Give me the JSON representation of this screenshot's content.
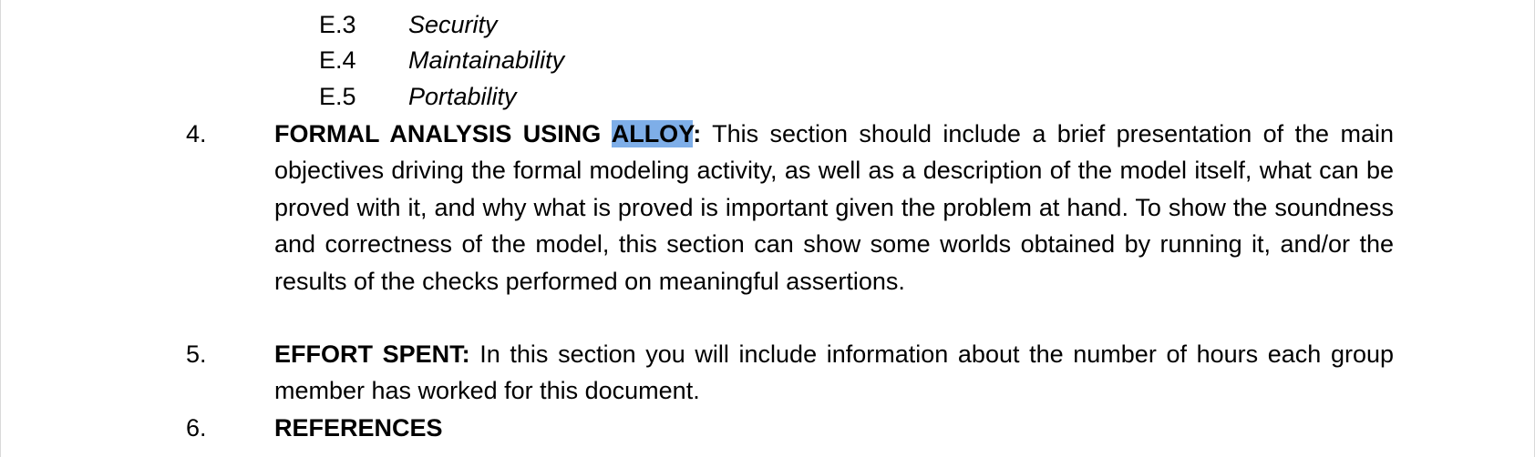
{
  "sub_items": [
    {
      "number": "E.3",
      "title": "Security"
    },
    {
      "number": "E.4",
      "title": "Maintainability"
    },
    {
      "number": "E.5",
      "title": "Portability"
    }
  ],
  "items": [
    {
      "number": "4.",
      "lead_before_selection": "FORMAL ANALYSIS USING ",
      "lead_selected": "ALLOY",
      "lead_after_selection": ":",
      "body": " This section should include a brief presentation of the main objectives driving the formal modeling activity, as well as a description of the model itself, what can be proved with it, and why what is proved is important given the problem at hand. To show the soundness and correctness of the model, this section can show some worlds obtained by running it, and/or the results of the checks performed on meaningful assertions."
    },
    {
      "number": "5.",
      "lead": "EFFORT SPENT:",
      "body": " In this section you will include information about the number of hours each group member has worked for this document."
    },
    {
      "number": "6.",
      "lead": "REFERENCES"
    }
  ],
  "colors": {
    "selection_highlight": "#7eaee8",
    "text": "#000000",
    "page": "#ffffff"
  }
}
